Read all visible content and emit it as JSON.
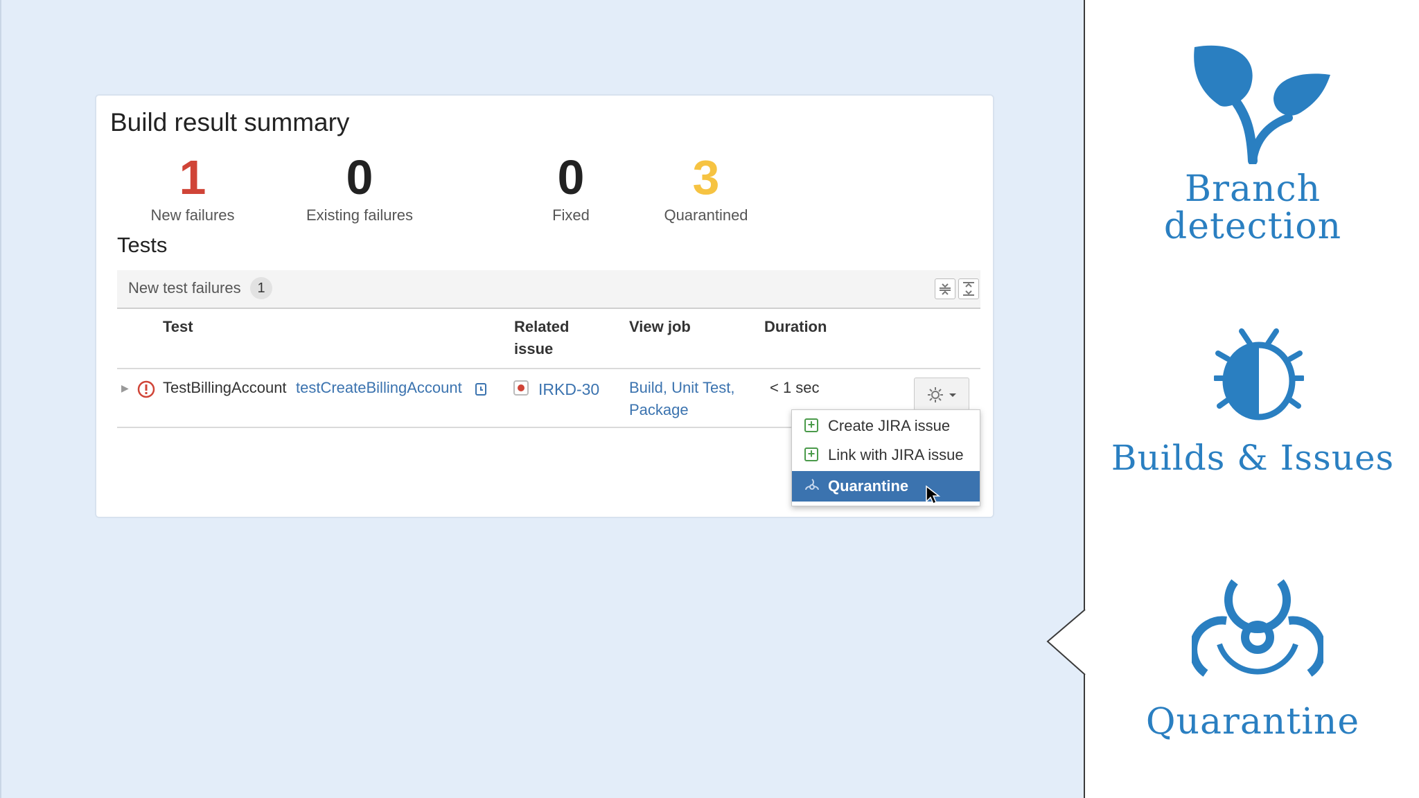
{
  "summary": {
    "title": "Build result summary",
    "stats": [
      {
        "value": "1",
        "label": "New failures",
        "color": "#d04437"
      },
      {
        "value": "0",
        "label": "Existing failures",
        "color": "#222222"
      },
      {
        "value": "0",
        "label": "Fixed",
        "color": "#222222"
      },
      {
        "value": "3",
        "label": "Quarantined",
        "color": "#f6c342"
      }
    ]
  },
  "tests": {
    "heading": "Tests",
    "panel_label": "New test failures",
    "panel_count": "1",
    "columns": {
      "test": "Test",
      "related_1": "Related",
      "related_2": "issue",
      "view_job": "View job",
      "duration": "Duration"
    },
    "row": {
      "class_name": "TestBillingAccount",
      "method_name": "testCreateBillingAccount",
      "issue": "IRKD-30",
      "view_job_1": "Build, Unit Test,",
      "view_job_2": "Package",
      "duration": "< 1 sec"
    }
  },
  "menu": {
    "items": [
      "Create JIRA issue",
      "Link with JIRA issue",
      "Quarantine"
    ],
    "selected": "Quarantine"
  },
  "features": {
    "branch_1": "Branch",
    "branch_2": "detection",
    "builds": "Builds & Issues",
    "quarantine": "Quarantine"
  },
  "icons": {
    "failure": "error-circle-icon",
    "issue": "jira-bug-icon",
    "gear": "gear-icon",
    "sprout": "sprout-icon",
    "bug": "bug-icon",
    "biohazard": "biohazard-icon"
  },
  "colors": {
    "accent": "#2a7fc1",
    "link": "#3b73af",
    "error": "#d04437",
    "warning": "#f6c342"
  }
}
